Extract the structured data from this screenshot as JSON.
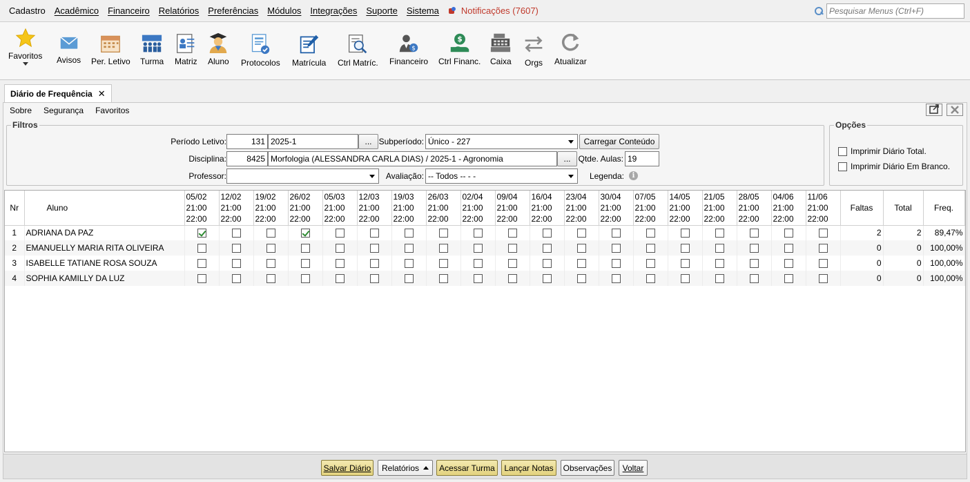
{
  "menubar": {
    "items": [
      "Cadastro",
      "Acadêmico",
      "Financeiro",
      "Relatórios",
      "Preferências",
      "Módulos",
      "Integrações",
      "Suporte",
      "Sistema"
    ],
    "notifications": "Notificações (7607)",
    "search_placeholder": "Pesquisar Menus (Ctrl+F)"
  },
  "toolbar": {
    "favoritos": "Favoritos",
    "avisos": "Avisos",
    "per_letivo": "Per. Letivo",
    "turma": "Turma",
    "matriz": "Matriz",
    "aluno": "Aluno",
    "protocolos": "Protocolos",
    "matricula": "Matrícula",
    "ctrl_matric": "Ctrl Matríc.",
    "financeiro": "Financeiro",
    "ctrl_financ": "Ctrl Financ.",
    "caixa": "Caixa",
    "orgs": "Orgs",
    "atualizar": "Atualizar"
  },
  "tab": {
    "title": "Diário de Frequência",
    "close": "✕"
  },
  "submenu": {
    "sobre": "Sobre",
    "seguranca": "Segurança",
    "favoritos": "Favoritos"
  },
  "filtros": {
    "legend": "Filtros",
    "periodo_label": "Período Letivo:",
    "periodo_code": "131",
    "periodo_name": "2025-1",
    "dots": "...",
    "subperiodo_label": "Subperíodo:",
    "subperiodo_value": "Único - 227",
    "carregar": "Carregar Conteúdo",
    "disciplina_label": "Disciplina:",
    "disciplina_code": "8425",
    "disciplina_name": "Morfologia  (ALESSANDRA CARLA DIAS) / 2025-1 - Agronomia",
    "qtde_label": "Qtde. Aulas:",
    "qtde_value": "19",
    "professor_label": "Professor:",
    "professor_value": "",
    "avaliacao_label": "Avaliação:",
    "avaliacao_value": "-- Todos -- -  -",
    "legenda_label": "Legenda:",
    "info_glyph": "i"
  },
  "opcoes": {
    "legend": "Opções",
    "total": "Imprimir Diário Total.",
    "branco": "Imprimir Diário Em Branco."
  },
  "grid": {
    "headers": {
      "nr": "Nr",
      "aluno": "Aluno",
      "faltas": "Faltas",
      "total": "Total",
      "freq": "Freq."
    },
    "dates": [
      "05/02",
      "12/02",
      "19/02",
      "26/02",
      "05/03",
      "12/03",
      "19/03",
      "26/03",
      "02/04",
      "09/04",
      "16/04",
      "23/04",
      "30/04",
      "07/05",
      "14/05",
      "21/05",
      "28/05",
      "04/06",
      "11/06"
    ],
    "start_time": "21:00",
    "end_time": "22:00",
    "rows": [
      {
        "nr": "1",
        "name": "ADRIANA DA PAZ",
        "faltas": "2",
        "total": "2",
        "freq": "89,47%",
        "checks": [
          0,
          3
        ]
      },
      {
        "nr": "2",
        "name": "EMANUELLY MARIA RITA OLIVEIRA",
        "faltas": "0",
        "total": "0",
        "freq": "100,00%",
        "checks": []
      },
      {
        "nr": "3",
        "name": "ISABELLE TATIANE ROSA SOUZA",
        "faltas": "0",
        "total": "0",
        "freq": "100,00%",
        "checks": []
      },
      {
        "nr": "4",
        "name": "SOPHIA KAMILLY DA LUZ",
        "faltas": "0",
        "total": "0",
        "freq": "100,00%",
        "checks": []
      }
    ]
  },
  "bottom": {
    "salvar": "Salvar Diário",
    "relatorios": "Relatórios",
    "acessar": "Acessar Turma",
    "lancar": "Lançar Notas",
    "observacoes": "Observações",
    "voltar": "Voltar"
  }
}
